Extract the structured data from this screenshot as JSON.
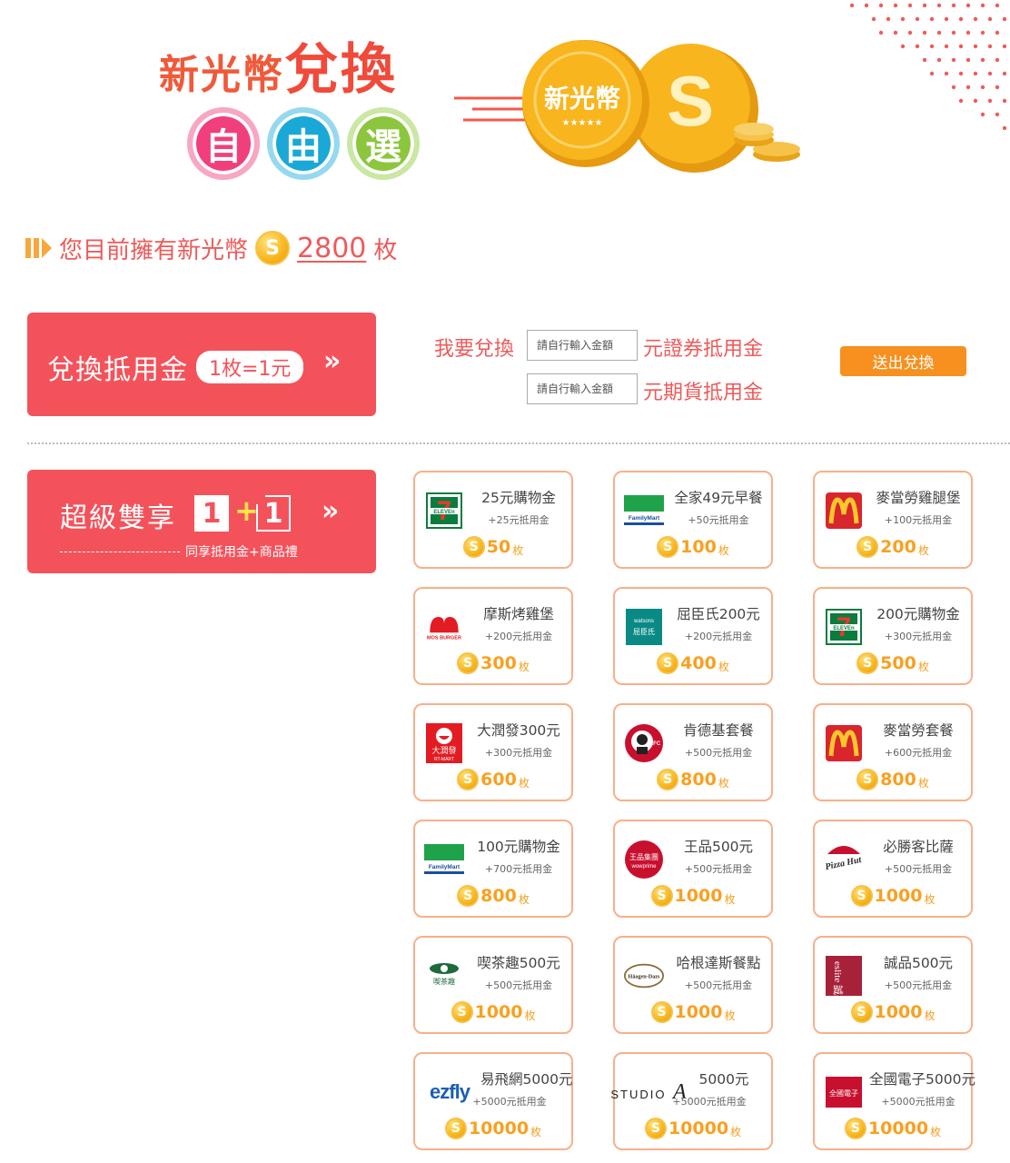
{
  "header": {
    "title_part1": "新光幣",
    "title_part2": "兌換",
    "circles": [
      "自",
      "由",
      "選"
    ],
    "coin_label": "新光幣",
    "coin_symbol": "S"
  },
  "balance": {
    "prefix": "您目前擁有新光幣",
    "coin_symbol": "S",
    "amount": "2800",
    "unit": "枚"
  },
  "exchange_panel": {
    "title": "兌換抵用金",
    "rate": "1枚=1元",
    "chevron": "»"
  },
  "exchange_form": {
    "label": "我要兌換",
    "input_placeholder": "請自行輸入金額",
    "voucher_suffix": "元證券抵用金",
    "futures_suffix": "元期貨抵用金",
    "submit_label": "送出兌換"
  },
  "double_panel": {
    "title": "超級雙享",
    "box1": "1",
    "plus": "+",
    "box2": "1",
    "chevron": "»",
    "subtitle": "同享抵用金+商品禮"
  },
  "rewards": [
    {
      "logo": "7-eleven-logo",
      "name": "25元購物金",
      "bonus": "+25元抵用金",
      "coins": "50",
      "unit": "枚"
    },
    {
      "logo": "familymart-logo",
      "name": "全家49元早餐",
      "bonus": "+50元抵用金",
      "coins": "100",
      "unit": "枚"
    },
    {
      "logo": "mcdonalds-logo",
      "name": "麥當勞雞腿堡",
      "bonus": "+100元抵用金",
      "coins": "200",
      "unit": "枚"
    },
    {
      "logo": "mos-burger-logo",
      "name": "摩斯烤雞堡",
      "bonus": "+200元抵用金",
      "coins": "300",
      "unit": "枚"
    },
    {
      "logo": "watsons-logo",
      "name": "屈臣氏200元",
      "bonus": "+200元抵用金",
      "coins": "400",
      "unit": "枚"
    },
    {
      "logo": "7-eleven-logo",
      "name": "200元購物金",
      "bonus": "+300元抵用金",
      "coins": "500",
      "unit": "枚"
    },
    {
      "logo": "rt-mart-logo",
      "name": "大潤發300元",
      "bonus": "+300元抵用金",
      "coins": "600",
      "unit": "枚"
    },
    {
      "logo": "kfc-logo",
      "name": "肯德基套餐",
      "bonus": "+500元抵用金",
      "coins": "800",
      "unit": "枚"
    },
    {
      "logo": "mcdonalds-logo",
      "name": "麥當勞套餐",
      "bonus": "+600元抵用金",
      "coins": "800",
      "unit": "枚"
    },
    {
      "logo": "familymart-logo",
      "name": "100元購物金",
      "bonus": "+700元抵用金",
      "coins": "800",
      "unit": "枚"
    },
    {
      "logo": "wowprime-logo",
      "name": "王品500元",
      "bonus": "+500元抵用金",
      "coins": "1000",
      "unit": "枚"
    },
    {
      "logo": "pizza-hut-logo",
      "name": "必勝客比薩",
      "bonus": "+500元抵用金",
      "coins": "1000",
      "unit": "枚"
    },
    {
      "logo": "chicha-logo",
      "name": "喫茶趣500元",
      "bonus": "+500元抵用金",
      "coins": "1000",
      "unit": "枚"
    },
    {
      "logo": "haagen-dazs-logo",
      "name": "哈根達斯餐點",
      "bonus": "+500元抵用金",
      "coins": "1000",
      "unit": "枚"
    },
    {
      "logo": "eslite-logo",
      "name": "誠品500元",
      "bonus": "+500元抵用金",
      "coins": "1000",
      "unit": "枚"
    },
    {
      "logo": "ezfly-logo",
      "name": "易飛網5000元",
      "bonus": "+5000元抵用金",
      "coins": "10000",
      "unit": "枚"
    },
    {
      "logo": "studio-a-logo",
      "name": "5000元",
      "bonus": "+5000元抵用金",
      "coins": "10000",
      "unit": "枚"
    },
    {
      "logo": "tk3c-logo",
      "name": "全國電子5000元",
      "bonus": "+5000元抵用金",
      "coins": "10000",
      "unit": "枚"
    }
  ],
  "logo_text": {
    "mos": "MOS BURGER",
    "familymart": "FamilyMart",
    "watsons_top": "watsons",
    "watsons_bottom": "屈臣氏",
    "rtmart": "大潤發",
    "rtmart_en": "RT-MART",
    "kfc": "KFC",
    "wowprime": "王品集團",
    "wowprime_en": "wowprime",
    "pizzahut": "Pizza Hut",
    "chicha": "喫茶趣",
    "haagen": "Häagen-Dazs",
    "eslite": "eslite 誠品",
    "ezfly": "ezfly",
    "studio": "STUDIO",
    "studio_a": "A",
    "tk3c": "全國電子",
    "eleven": "ELEVEn"
  },
  "colors": {
    "accent_red": "#f4525b",
    "orange": "#f7901e",
    "coin_gold": "#f8b51d",
    "card_border": "#f8b089"
  }
}
